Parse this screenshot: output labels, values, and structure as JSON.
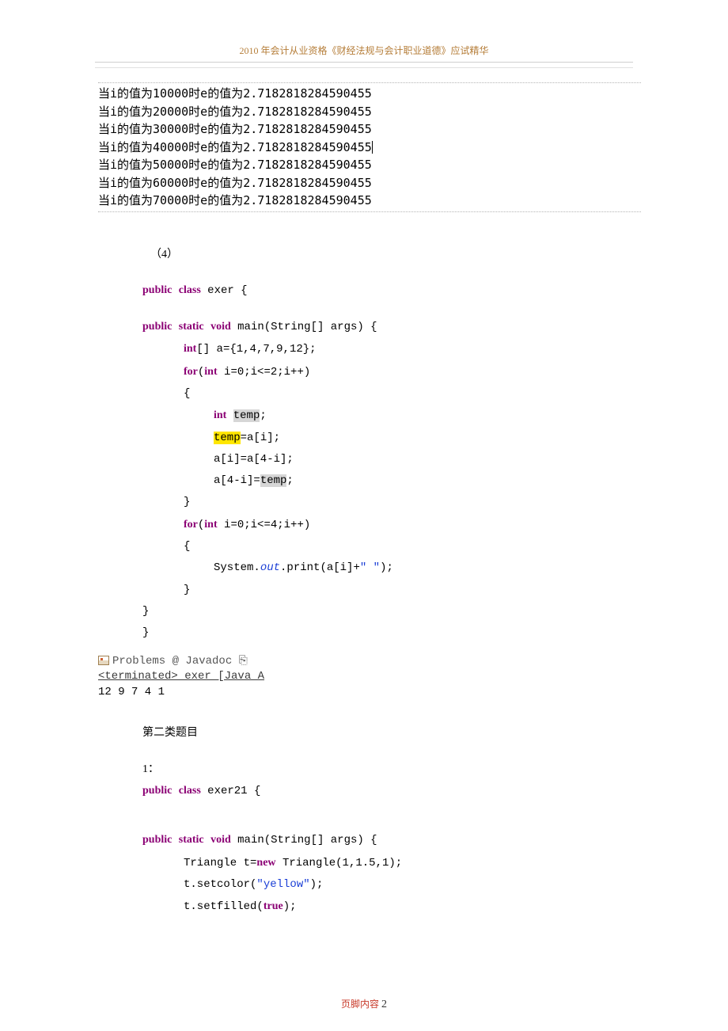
{
  "header": {
    "title": "2010 年会计从业资格《财经法规与会计职业道德》应试精华"
  },
  "output_box": {
    "lines": [
      "当i的值为10000时e的值为2.7182818284590455",
      "当i的值为20000时e的值为2.7182818284590455",
      "当i的值为30000时e的值为2.7182818284590455",
      "当i的值为40000时e的值为2.7182818284590455",
      "当i的值为50000时e的值为2.7182818284590455",
      "当i的值为60000时e的值为2.7182818284590455",
      "当i的值为70000时e的值为2.7182818284590455"
    ],
    "cursor_line_index": 3
  },
  "section4": {
    "label": "（4）",
    "code": {
      "kw_public": "public",
      "kw_class": "class",
      "kw_static": "static",
      "kw_void": "void",
      "kw_int": "int",
      "kw_for": "for",
      "class_name": " exer {",
      "main_sig_post": " main(String[] args) {",
      "arr_decl": "[] a={1,4,7,9,12};",
      "for1_head": " i=0;i<=2;i++)",
      "brace_open": "{",
      "temp_decl_sp": " ",
      "temp_word": "temp",
      "semicolon": ";",
      "temp_assign_rhs": "=a[i];",
      "line_ai": "a[i]=a[4-i];",
      "line_a4i_lhs": "a[4-i]=",
      "brace_close": "}",
      "for2_head": " i=0;i<=4;i++)",
      "sysout_pre": "System.",
      "sysout_out": "out",
      "sysout_mid": ".print(a[i]+",
      "sysout_str": "\" \"",
      "sysout_post": ");"
    }
  },
  "console": {
    "tabs_label": "Problems  @ Javadoc ",
    "terminated": "<terminated> exer [Java A",
    "output": "12 9 7 4 1"
  },
  "section2": {
    "title": "第二类题目",
    "num": "1：",
    "code": {
      "kw_public": "public",
      "kw_class": "class",
      "kw_static": "static",
      "kw_void": "void",
      "kw_new": "new",
      "kw_true": "true",
      "class_name": " exer21 {",
      "main_sig_post": " main(String[] args) {",
      "tri_new_pre": "Triangle t=",
      "tri_new_post": " Triangle(1,1.5,1);",
      "setcolor_pre": "t.setcolor(",
      "str_yellow": "\"yellow\"",
      "setcolor_post": ");",
      "setfilled_pre": "t.setfilled(",
      "setfilled_post": ");"
    }
  },
  "footer": {
    "label": "页脚内容",
    "num": "2"
  }
}
